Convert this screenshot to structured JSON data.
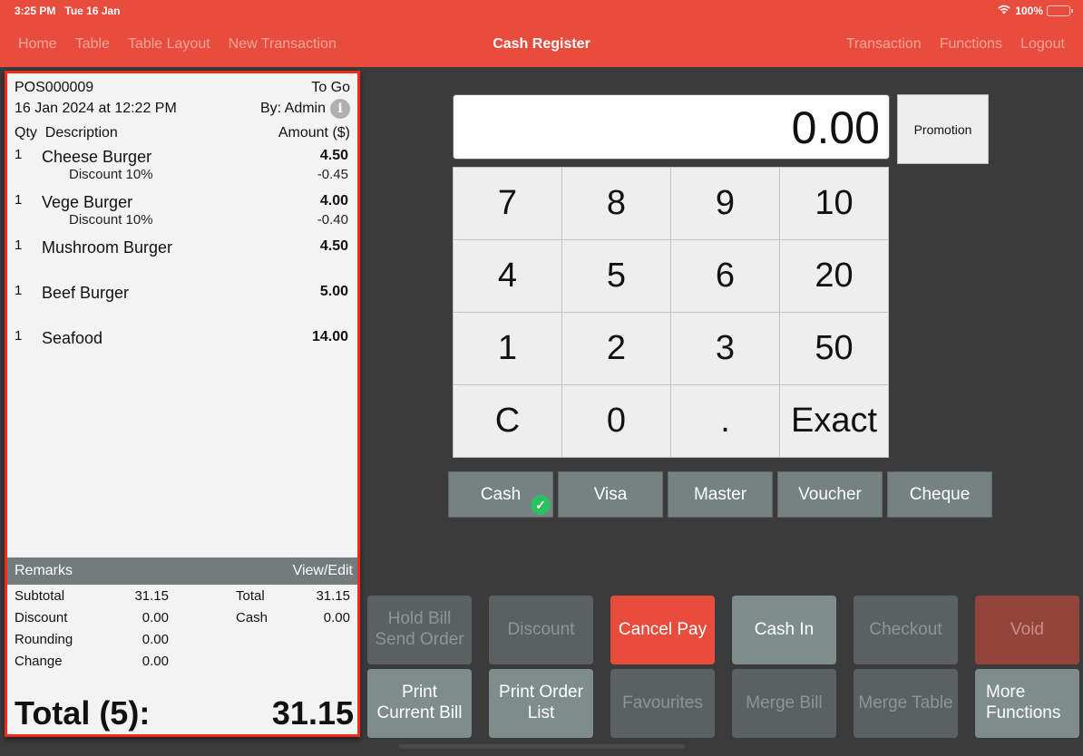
{
  "status_bar": {
    "time": "3:25 PM",
    "date": "Tue 16 Jan",
    "battery": "100%"
  },
  "nav": {
    "left": [
      "Home",
      "Table",
      "Table Layout",
      "New Transaction"
    ],
    "title": "Cash Register",
    "right": [
      "Transaction",
      "Functions",
      "Logout"
    ]
  },
  "receipt": {
    "id": "POS000009",
    "order_type": "To Go",
    "datetime": "16 Jan 2024 at 12:22 PM",
    "by": "By: Admin",
    "col_qty": "Qty",
    "col_desc": "Description",
    "col_amount": "Amount ($)",
    "items": [
      {
        "qty": "1",
        "name": "Cheese Burger",
        "amount": "4.50",
        "discount": "Discount 10%",
        "discount_amount": "-0.45"
      },
      {
        "qty": "1",
        "name": "Vege Burger",
        "amount": "4.00",
        "discount": "Discount 10%",
        "discount_amount": "-0.40"
      },
      {
        "qty": "1",
        "name": "Mushroom Burger",
        "amount": "4.50"
      },
      {
        "qty": "1",
        "name": "Beef Burger",
        "amount": "5.00"
      },
      {
        "qty": "1",
        "name": "Seafood",
        "amount": "14.00"
      }
    ],
    "remarks_label": "Remarks",
    "remarks_action": "View/Edit",
    "summary": {
      "subtotal_label": "Subtotal",
      "subtotal": "31.15",
      "discount_label": "Discount",
      "discount": "0.00",
      "rounding_label": "Rounding",
      "rounding": "0.00",
      "change_label": "Change",
      "change": "0.00",
      "total_label": "Total",
      "total": "31.15",
      "cash_label": "Cash",
      "cash": "0.00"
    },
    "grand_label": "Total (5):",
    "grand_total": "31.15"
  },
  "display_value": "0.00",
  "promotion_label": "Promotion",
  "keypad": [
    "7",
    "8",
    "9",
    "10",
    "4",
    "5",
    "6",
    "20",
    "1",
    "2",
    "3",
    "50",
    "C",
    "0",
    ".",
    "Exact"
  ],
  "payment_types": [
    {
      "label": "Cash",
      "selected": true
    },
    {
      "label": "Visa"
    },
    {
      "label": "Master"
    },
    {
      "label": "Voucher"
    },
    {
      "label": "Cheque"
    }
  ],
  "actions": {
    "hold_bill_1": "Hold Bill",
    "hold_bill_2": "Send Order",
    "discount": "Discount",
    "cancel_pay": "Cancel Pay",
    "cash_in": "Cash In",
    "checkout": "Checkout",
    "void": "Void",
    "print_bill_1": "Print",
    "print_bill_2": "Current Bill",
    "print_order_1": "Print Order",
    "print_order_2": "List",
    "favourites": "Favourites",
    "merge_bill": "Merge Bill",
    "merge_table": "Merge Table",
    "more_1": "More",
    "more_2": "Functions"
  },
  "colors": {
    "brand": "#e84c3d",
    "selected_check": "#2dbf64"
  }
}
